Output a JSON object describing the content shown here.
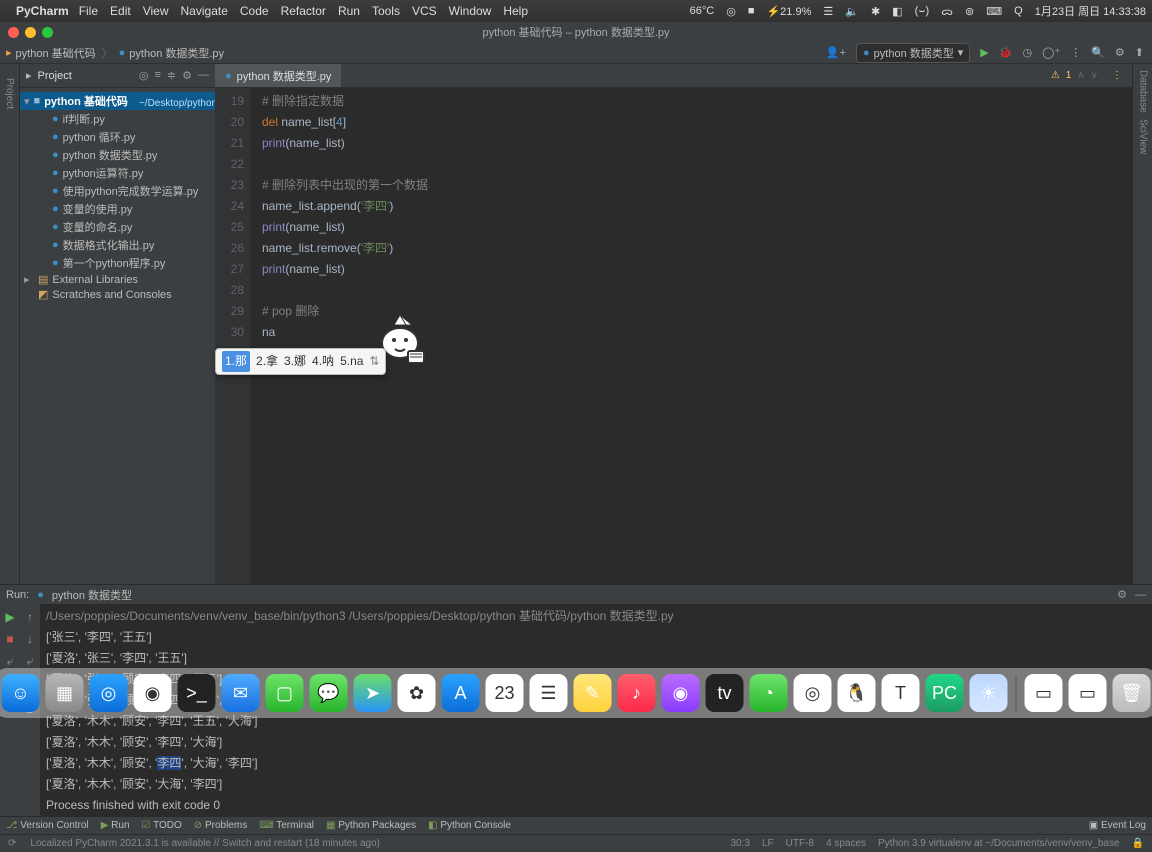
{
  "macos": {
    "app": "PyCharm",
    "menus": [
      "File",
      "Edit",
      "View",
      "Navigate",
      "Code",
      "Refactor",
      "Run",
      "Tools",
      "VCS",
      "Window",
      "Help"
    ],
    "right": [
      "66°C",
      "◎",
      "■",
      "⚡21.9%",
      "☰",
      "🔈",
      "✱",
      "◧",
      "(⌣)",
      "ᯅ",
      "⊚",
      "⌨",
      "Q",
      "1月23日 周日 14:33:38"
    ]
  },
  "window": {
    "title": "python 基础代码 – python 数据类型.py"
  },
  "breadcrumbs": [
    "python 基础代码",
    "python 数据类型.py"
  ],
  "toolbar": {
    "run_config": "python 数据类型"
  },
  "project": {
    "title": "Project",
    "root": "python 基础代码",
    "root_suffix": "~/Desktop/python 基…",
    "files": [
      "if判断.py",
      "python 循环.py",
      "python 数据类型.py",
      "python运算符.py",
      "使用python完成数学运算.py",
      "变量的使用.py",
      "变量的命名.py",
      "数据格式化输出.py",
      "第一个python程序.py"
    ],
    "external": "External Libraries",
    "scratches": "Scratches and Consoles"
  },
  "editor": {
    "tab": "python 数据类型.py",
    "warn": "1",
    "lines": [
      {
        "n": 19,
        "t": "comment",
        "text": "# 删除指定数据"
      },
      {
        "n": 20,
        "t": "code",
        "text": "del name_list[4]"
      },
      {
        "n": 21,
        "t": "code",
        "text": "print(name_list)"
      },
      {
        "n": 22,
        "t": "blank",
        "text": ""
      },
      {
        "n": 23,
        "t": "comment",
        "text": "# 删除列表中出现的第一个数据"
      },
      {
        "n": 24,
        "t": "code",
        "text": "name_list.append('李四')"
      },
      {
        "n": 25,
        "t": "code",
        "text": "print(name_list)"
      },
      {
        "n": 26,
        "t": "code",
        "text": "name_list.remove('李四')"
      },
      {
        "n": 27,
        "t": "code",
        "text": "print(name_list)"
      },
      {
        "n": 28,
        "t": "blank",
        "text": ""
      },
      {
        "n": 29,
        "t": "comment",
        "text": "# pop 删除"
      },
      {
        "n": 30,
        "t": "code",
        "text": "na"
      }
    ],
    "ime": {
      "candidates": [
        "1.那",
        "2.拿",
        "3.娜",
        "4.呐",
        "5.na"
      ],
      "selected": 0
    }
  },
  "run": {
    "label": "Run:",
    "name": "python 数据类型",
    "path": "/Users/poppies/Documents/venv/venv_base/bin/python3  /Users/poppies/Desktop/python 基础代码/python 数据类型.py",
    "outputs": [
      "['张三', '李四', '王五']",
      "['夏洛', '张三', '李四', '王五']",
      "['夏洛', '张三', '顾安', '李四', '王五']",
      "['夏洛', '张三', '顾安', '李四', '王五', '大海']",
      "['夏洛', '木木', '顾安', '李四', '王五', '大海']",
      "['夏洛', '木木', '顾安', '李四', '大海']",
      "['夏洛', '木木', '顾安', '李四', '大海', '李四']",
      "['夏洛', '木木', '顾安', '大海', '李四']"
    ],
    "exit": "Process finished with exit code 0"
  },
  "bottom": {
    "items": [
      "Version Control",
      "Run",
      "TODO",
      "Problems",
      "Terminal",
      "Python Packages",
      "Python Console"
    ],
    "right": "Event Log"
  },
  "status": {
    "msg": "Localized PyCharm 2021.3.1 is available // Switch and restart (18 minutes ago)",
    "right": [
      "30:3",
      "LF",
      "UTF-8",
      "4 spaces",
      "Python 3.9 virtualenv at ~/Documents/venv/venv_base"
    ]
  },
  "dock": {
    "apps": [
      {
        "name": "finder",
        "bg": "linear-gradient(#3fb1ff,#0a6bd8)",
        "glyph": "☺"
      },
      {
        "name": "launchpad",
        "bg": "linear-gradient(#b6b6b6,#8a8a8a)",
        "glyph": "▦"
      },
      {
        "name": "safari",
        "bg": "linear-gradient(#2aa3ff,#0d6dd9)",
        "glyph": "◎"
      },
      {
        "name": "chrome",
        "bg": "#fff",
        "glyph": "◉"
      },
      {
        "name": "terminal",
        "bg": "#222",
        "glyph": ">_"
      },
      {
        "name": "mail",
        "bg": "linear-gradient(#4facff,#186fe0)",
        "glyph": "✉"
      },
      {
        "name": "facetime",
        "bg": "linear-gradient(#6ee36b,#28b52c)",
        "glyph": "▢"
      },
      {
        "name": "messages",
        "bg": "linear-gradient(#6ee36b,#28b52c)",
        "glyph": "💬"
      },
      {
        "name": "maps",
        "bg": "linear-gradient(#6bdc6a,#2a94f6)",
        "glyph": "➤"
      },
      {
        "name": "photos",
        "bg": "#fff",
        "glyph": "✿"
      },
      {
        "name": "appstore",
        "bg": "linear-gradient(#2aa3ff,#0d6dd9)",
        "glyph": "A"
      },
      {
        "name": "calendar",
        "bg": "#fff",
        "glyph": "23"
      },
      {
        "name": "reminders",
        "bg": "#fff",
        "glyph": "☰"
      },
      {
        "name": "notes",
        "bg": "linear-gradient(#ffe67a,#ffd23c)",
        "glyph": "✎"
      },
      {
        "name": "music",
        "bg": "linear-gradient(#ff5f6d,#fc2a4a)",
        "glyph": "♪"
      },
      {
        "name": "podcasts",
        "bg": "linear-gradient(#b96bff,#8a3cff)",
        "glyph": "◉"
      },
      {
        "name": "tv",
        "bg": "#222",
        "glyph": "tv"
      },
      {
        "name": "wechat",
        "bg": "linear-gradient(#6ee36b,#28b52c)",
        "glyph": "◔"
      },
      {
        "name": "qqbrowser",
        "bg": "#fff",
        "glyph": "◎"
      },
      {
        "name": "qq",
        "bg": "#fff",
        "glyph": "🐧"
      },
      {
        "name": "typora",
        "bg": "#fff",
        "glyph": "T"
      },
      {
        "name": "pycharm",
        "bg": "linear-gradient(#21d789,#1c9c62)",
        "glyph": "PC"
      },
      {
        "name": "weather",
        "bg": "linear-gradient(#bcd7ff,#d5e7ff)",
        "glyph": "☀"
      }
    ],
    "right": [
      {
        "name": "pages",
        "bg": "#fff",
        "glyph": "▭"
      },
      {
        "name": "numbers",
        "bg": "#fff",
        "glyph": "▭"
      },
      {
        "name": "trash",
        "bg": "linear-gradient(#d8d8d8,#bcbcbc)",
        "glyph": "🗑"
      }
    ]
  }
}
